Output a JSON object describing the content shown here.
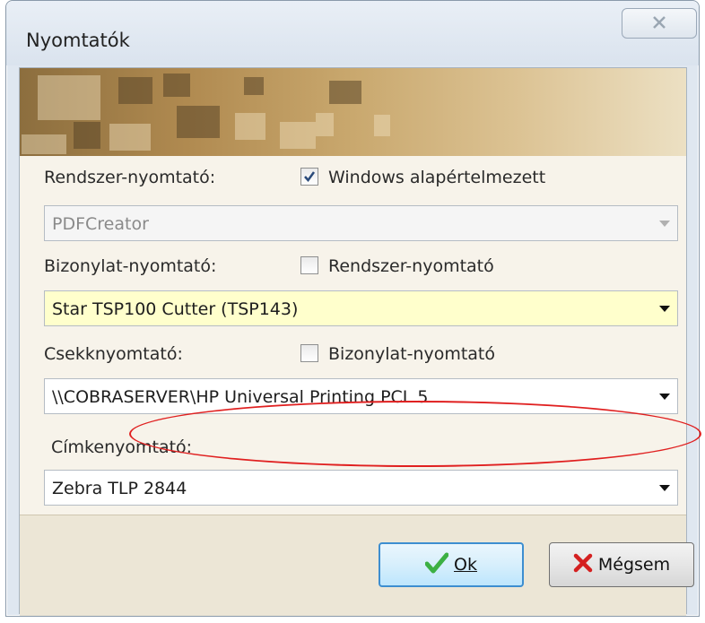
{
  "window": {
    "title": "Nyomtatók"
  },
  "system_printer": {
    "label": "Rendszer-nyomtató:",
    "checkbox_label": "Windows alapértelmezett",
    "checkbox_checked": true,
    "combo_value": "PDFCreator",
    "combo_disabled": true
  },
  "document_printer": {
    "label": "Bizonylat-nyomtató:",
    "checkbox_label": "Rendszer-nyomtató",
    "checkbox_checked": false,
    "combo_value": "Star TSP100 Cutter (TSP143)"
  },
  "check_printer": {
    "label": "Csekknyomtató:",
    "checkbox_label": "Bizonylat-nyomtató",
    "checkbox_checked": false,
    "combo_value": "\\\\COBRASERVER\\HP Universal Printing PCL 5"
  },
  "label_printer": {
    "label": "Címkenyomtató:",
    "combo_value": "Zebra TLP 2844"
  },
  "buttons": {
    "ok_label": "Ok",
    "cancel_label": "Mégsem"
  },
  "colors": {
    "highlight_combo": "#ffffcc",
    "annotation_ellipse": "#e02020",
    "ok_icon": "#3cb043",
    "cancel_icon": "#d42020"
  }
}
